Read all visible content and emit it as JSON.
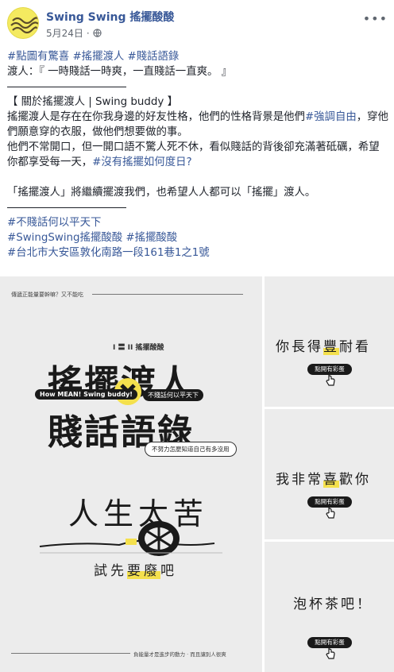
{
  "post": {
    "page_name": "Swing Swing 搖擺酸酸",
    "date": "5月24日",
    "separator": "·",
    "more_icon": "more-options-icon",
    "privacy_icon": "globe-icon",
    "hashtags_line1": [
      "#點圖有驚喜",
      "#搖擺渡人",
      "#賤話語錄"
    ],
    "quote_line": "渡人：『 一時賤話一時爽，一直賤話一直爽。 』",
    "about_heading": "【 關於搖擺渡人 | Swing buddy 】",
    "para1_before": "搖擺渡人是存在在你我身邊的好友性格，他們的性格背景是他們",
    "para1_tag": "#強調自由",
    "para1_after": "，穿他們願意穿的衣服，做他們想要做的事。",
    "para2_before": "他們不常開口，但一開口語不驚人死不休，看似賤話的背後卻充滿著砥礪，希望你都享受每一天，",
    "para2_tag": "#沒有搖擺如何度日?",
    "para3": "「搖擺渡人」將繼續擺渡我們，也希望人人都可以「搖擺」渡人。",
    "footer_tags": [
      "#不賤話何以平天下",
      "#SwingSwing搖擺酸酸",
      "#搖擺酸酸",
      "#台北市大安區敦化南路一段161巷1之1號"
    ]
  },
  "poster": {
    "top_text": "傳遞正能量要幹嘛？又不能吃",
    "brand": "I 〓 II 搖擺酸酸",
    "title_line1": "搖擺渡人",
    "title_line2": "賤話語錄",
    "mean_pill": "How MEAN! Swing buddy!",
    "sub_pill": "不賤話何以平天下",
    "bubble": "不努力怎麼知道自己有多沒用",
    "life": "人生太苦",
    "try_prefix": "試先",
    "try_highlight": "要廢",
    "try_suffix": "吧",
    "bottom_text": "負能量才是進步的動力 · 而且讓別人很爽"
  },
  "side_cards": [
    {
      "text_before": "你長得",
      "text_highlight": "豐",
      "text_after": "耐看",
      "button": "點開有彩蛋"
    },
    {
      "text_before": "我非常",
      "text_highlight": "喜",
      "text_after": "歡你",
      "button": "點開有彩蛋"
    },
    {
      "text_before": "泡杯茶吧！",
      "text_highlight": "",
      "text_after": "",
      "button": "點開有彩蛋"
    }
  ],
  "colors": {
    "link": "#385898",
    "text": "#1d2129",
    "meta": "#616770",
    "accent_yellow": "#f4e04d",
    "card_bg": "#ececec"
  }
}
